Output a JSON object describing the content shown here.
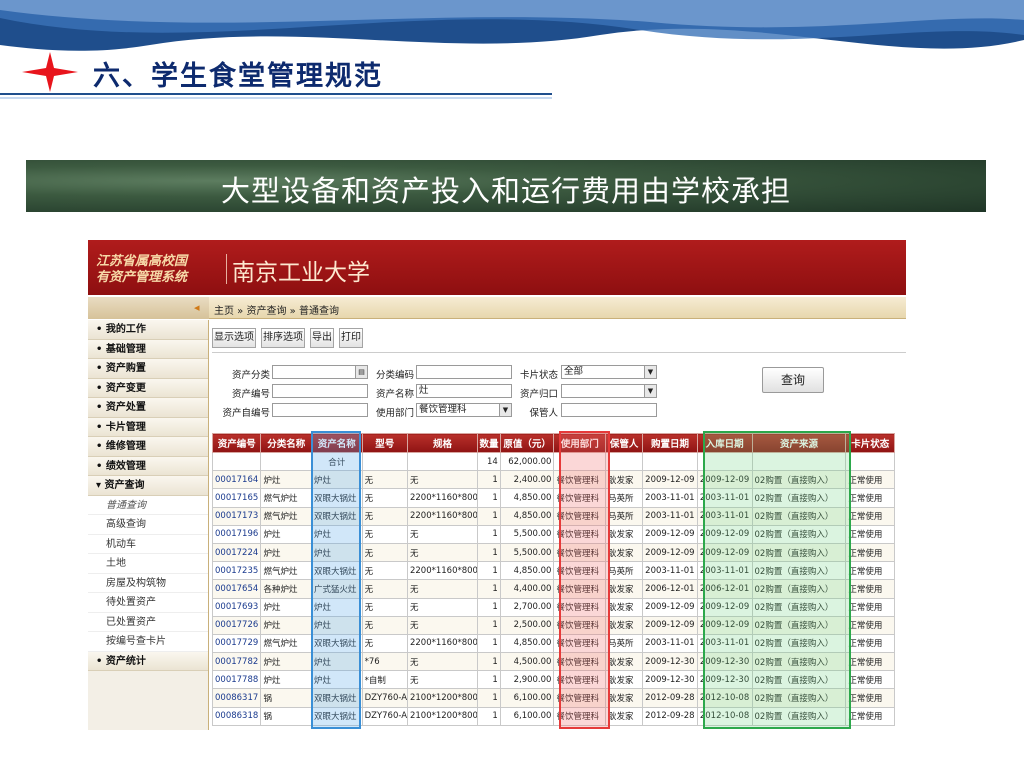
{
  "slide": {
    "title": "六、学生食堂管理规范",
    "banner": "大型设备和资产投入和运行费用由学校承担"
  },
  "system": {
    "logo_line1": "江苏省属高校国",
    "logo_line2": "有资产管理系统",
    "school_name": "南京工业大学",
    "breadcrumb": "主页 » 资产查询 » 普通查询",
    "sidebar": {
      "items": [
        {
          "label": "• 我的工作"
        },
        {
          "label": "• 基础管理"
        },
        {
          "label": "• 资产购置"
        },
        {
          "label": "• 资产变更"
        },
        {
          "label": "• 资产处置"
        },
        {
          "label": "• 卡片管理"
        },
        {
          "label": "• 维修管理"
        },
        {
          "label": "• 绩效管理"
        },
        {
          "label": "▾ 资产查询"
        }
      ],
      "subitems": [
        {
          "label": "普通查询"
        },
        {
          "label": "高级查询"
        },
        {
          "label": "机动车"
        },
        {
          "label": "土地"
        },
        {
          "label": "房屋及构筑物"
        },
        {
          "label": "待处置资产"
        },
        {
          "label": "已处置资产"
        },
        {
          "label": "按编号查卡片"
        }
      ],
      "last_item": "• 资产统计"
    },
    "toolbar": {
      "show_options": "显示选项",
      "sort_options": "排序选项",
      "export": "导出",
      "print": "打印"
    },
    "query": {
      "asset_category_label": "资产分类",
      "category_code_label": "分类编码",
      "card_status_label": "卡片状态",
      "card_status_value": "全部",
      "asset_no_label": "资产编号",
      "asset_name_label": "资产名称",
      "asset_name_value": "灶",
      "asset_belong_label": "资产归口",
      "self_no_label": "资产自编号",
      "dept_label": "使用部门",
      "dept_value": "餐饮管理科",
      "keeper_label": "保管人",
      "query_button": "查询"
    },
    "table": {
      "headers": [
        "资产编号",
        "分类名称",
        "资产名称",
        "型号",
        "规格",
        "数量",
        "原值（元）",
        "使用部门",
        "保管人",
        "购置日期",
        "入库日期",
        "资产来源",
        "卡片状态"
      ],
      "total_label": "合计",
      "total_qty": "14",
      "total_value": "62,000.00",
      "rows": [
        [
          "00017164",
          "炉灶",
          "炉灶",
          "无",
          "无",
          "1",
          "2,400.00",
          "餐饮管理科",
          "耿发家",
          "2009-12-09",
          "2009-12-09",
          "02购置（直接购入）",
          "正常使用"
        ],
        [
          "00017165",
          "燃气炉灶",
          "双眼大锅灶",
          "无",
          "2200*1160*800",
          "1",
          "4,850.00",
          "餐饮管理科",
          "马英所",
          "2003-11-01",
          "2003-11-01",
          "02购置（直接购入）",
          "正常使用"
        ],
        [
          "00017173",
          "燃气炉灶",
          "双眼大锅灶",
          "无",
          "2200*1160*800",
          "1",
          "4,850.00",
          "餐饮管理科",
          "马英所",
          "2003-11-01",
          "2003-11-01",
          "02购置（直接购入）",
          "正常使用"
        ],
        [
          "00017196",
          "炉灶",
          "炉灶",
          "无",
          "无",
          "1",
          "5,500.00",
          "餐饮管理科",
          "耿发家",
          "2009-12-09",
          "2009-12-09",
          "02购置（直接购入）",
          "正常使用"
        ],
        [
          "00017224",
          "炉灶",
          "炉灶",
          "无",
          "无",
          "1",
          "5,500.00",
          "餐饮管理科",
          "耿发家",
          "2009-12-09",
          "2009-12-09",
          "02购置（直接购入）",
          "正常使用"
        ],
        [
          "00017235",
          "燃气炉灶",
          "双眼大锅灶",
          "无",
          "2200*1160*800",
          "1",
          "4,850.00",
          "餐饮管理科",
          "马英所",
          "2003-11-01",
          "2003-11-01",
          "02购置（直接购入）",
          "正常使用"
        ],
        [
          "00017654",
          "各种炉灶",
          "广式猛火灶",
          "无",
          "无",
          "1",
          "4,400.00",
          "餐饮管理科",
          "耿发家",
          "2006-12-01",
          "2006-12-01",
          "02购置（直接购入）",
          "正常使用"
        ],
        [
          "00017693",
          "炉灶",
          "炉灶",
          "无",
          "无",
          "1",
          "2,700.00",
          "餐饮管理科",
          "耿发家",
          "2009-12-09",
          "2009-12-09",
          "02购置（直接购入）",
          "正常使用"
        ],
        [
          "00017726",
          "炉灶",
          "炉灶",
          "无",
          "无",
          "1",
          "2,500.00",
          "餐饮管理科",
          "耿发家",
          "2009-12-09",
          "2009-12-09",
          "02购置（直接购入）",
          "正常使用"
        ],
        [
          "00017729",
          "燃气炉灶",
          "双眼大锅灶",
          "无",
          "2200*1160*800",
          "1",
          "4,850.00",
          "餐饮管理科",
          "马英所",
          "2003-11-01",
          "2003-11-01",
          "02购置（直接购入）",
          "正常使用"
        ],
        [
          "00017782",
          "炉灶",
          "炉灶",
          "*76",
          "无",
          "1",
          "4,500.00",
          "餐饮管理科",
          "耿发家",
          "2009-12-30",
          "2009-12-30",
          "02购置（直接购入）",
          "正常使用"
        ],
        [
          "00017788",
          "炉灶",
          "炉灶",
          "*自制",
          "无",
          "1",
          "2,900.00",
          "餐饮管理科",
          "耿发家",
          "2009-12-30",
          "2009-12-30",
          "02购置（直接购入）",
          "正常使用"
        ],
        [
          "00086317",
          "锅",
          "双眼大锅灶",
          "DZY760-A",
          "2100*1200*800",
          "1",
          "6,100.00",
          "餐饮管理科",
          "耿发家",
          "2012-09-28",
          "2012-10-08",
          "02购置（直接购入）",
          "正常使用"
        ],
        [
          "00086318",
          "锅",
          "双眼大锅灶",
          "DZY760-A",
          "2100*1200*800",
          "1",
          "6,100.00",
          "餐饮管理科",
          "耿发家",
          "2012-09-28",
          "2012-10-08",
          "02购置（直接购入）",
          "正常使用"
        ]
      ]
    },
    "colors": {
      "header_red": "#9b1515",
      "highlight_blue": "#3a8fd6",
      "highlight_red": "#e63a3a",
      "highlight_green": "#2ca84b",
      "title_navy": "#0d2a6e"
    }
  }
}
